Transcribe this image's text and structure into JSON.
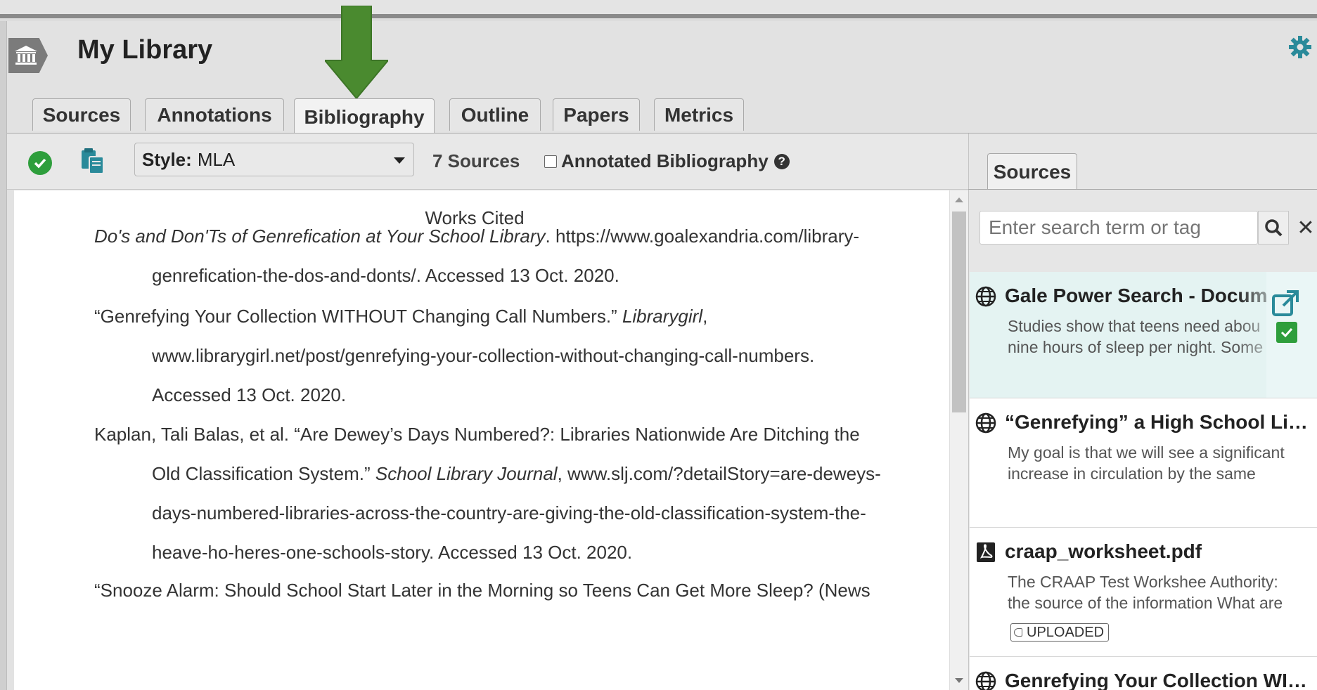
{
  "header": {
    "title": "My Library"
  },
  "tabs": [
    {
      "label": "Sources"
    },
    {
      "label": "Annotations"
    },
    {
      "label": "Bibliography"
    },
    {
      "label": "Outline"
    },
    {
      "label": "Papers"
    },
    {
      "label": "Metrics"
    }
  ],
  "active_tab": "Bibliography",
  "toolbar": {
    "style_label": "Style:",
    "style_value": "MLA",
    "source_count": "7 Sources",
    "annotated_label": "Annotated Bibliography",
    "annotated_checked": false
  },
  "document": {
    "title": "Works Cited",
    "entries": [
      {
        "lines": [
          "Do's and Don'Ts of Genrefication at Your School Library. https://www.goalexandria.com/library-",
          "genrefication-the-dos-and-donts/. Accessed 13 Oct. 2020."
        ]
      },
      {
        "lines": [
          "“Genrefying Your Collection WITHOUT Changing Call Numbers.” Librarygirl,",
          "www.librarygirl.net/post/genrefying-your-collection-without-changing-call-numbers.",
          "Accessed 13 Oct. 2020."
        ]
      },
      {
        "lines": [
          "Kaplan, Tali Balas, et al. “Are Dewey’s Days Numbered?: Libraries Nationwide Are Ditching the",
          "Old Classification System.” School Library Journal, www.slj.com/?detailStory=are-deweys-",
          "days-numbered-libraries-across-the-country-are-giving-the-old-classification-system-the-",
          "heave-ho-heres-one-schools-story. Accessed 13 Oct. 2020."
        ]
      },
      {
        "lines": [
          "“Snooze Alarm: Should School Start Later in the Morning so Teens Can Get More Sleep? (News"
        ]
      }
    ],
    "italic_parts": {
      "e0": "Do's and Don'Ts of Genrefication at Your School Library",
      "e1": "Librarygirl",
      "e2": "School Library Journal"
    }
  },
  "right_panel": {
    "tab": "Sources",
    "search_placeholder": "Enter search term or tag",
    "cards": [
      {
        "icon": "globe-icon",
        "title": "Gale Power Search - Docume",
        "snippet": [
          "Studies show that teens need abou",
          "nine hours of sleep per night. Some"
        ],
        "selected": true
      },
      {
        "icon": "globe-icon",
        "title": "“Genrefying” a High School Li…",
        "snippet": [
          "My goal is that we will see a significant",
          "increase in circulation by the same"
        ],
        "selected": false
      },
      {
        "icon": "pdf-icon",
        "title": "craap_worksheet.pdf",
        "snippet": [
          "The CRAAP Test Workshee Authority:",
          "the source of the information What are"
        ],
        "tag": "UPLOADED",
        "selected": false
      },
      {
        "icon": "globe-icon",
        "title": "Genrefying Your Collection WI…",
        "snippet": [],
        "selected": false
      }
    ]
  },
  "colors": {
    "accent_green": "#2e9e3c",
    "arrow_green": "#4a8a2f",
    "teal_icon": "#2a8a9a",
    "selected_card": "#e4f3f2"
  }
}
